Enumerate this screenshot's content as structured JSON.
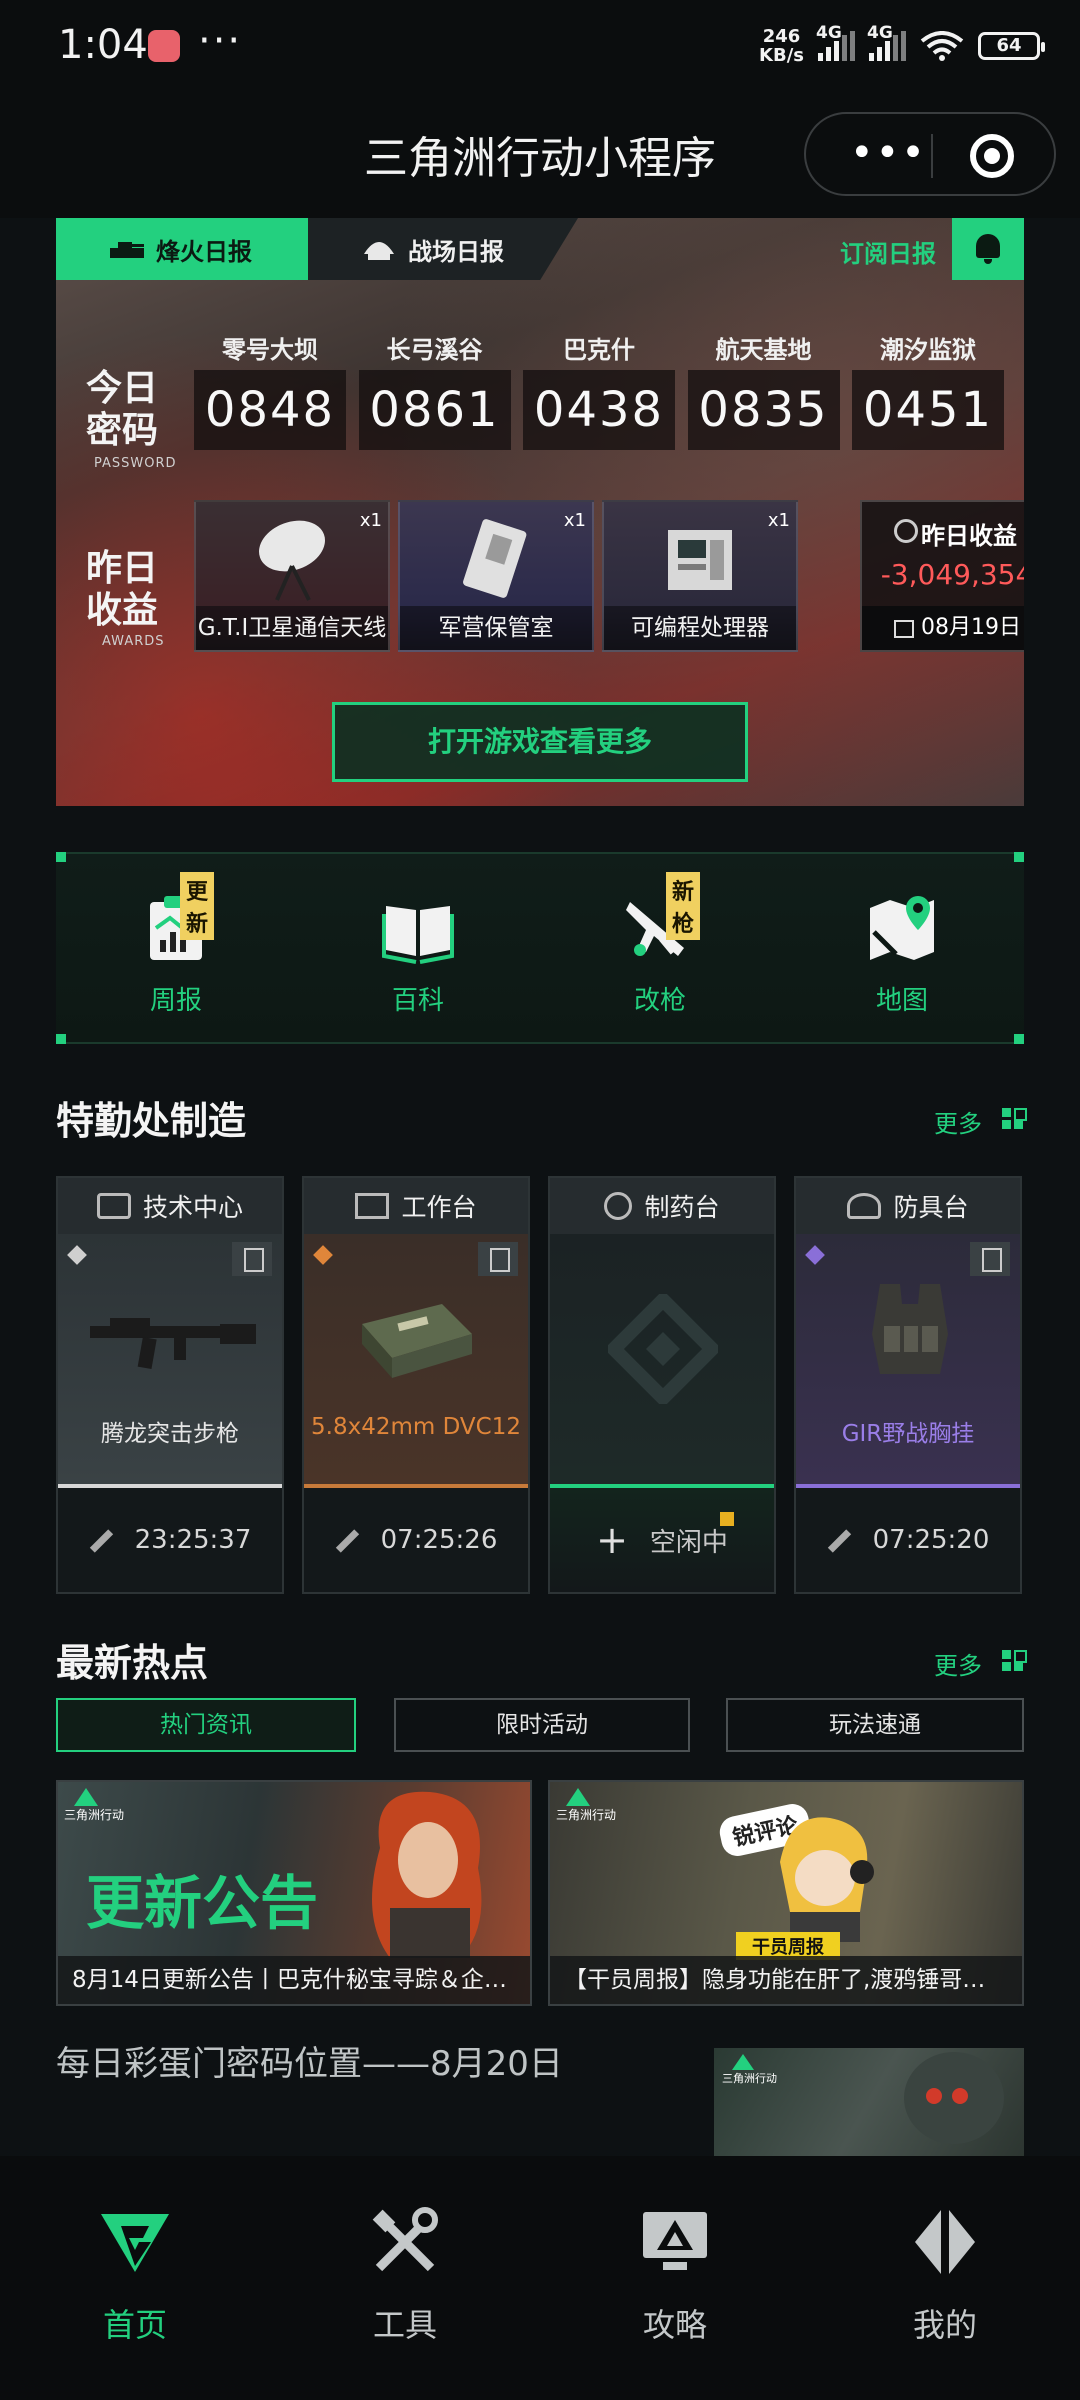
{
  "status_bar": {
    "time": "1:04",
    "more": "···",
    "speed_top": "246",
    "speed_bottom": "KB/s",
    "net1": "4G",
    "net2": "4G",
    "wifi_sub": "6",
    "battery": "64"
  },
  "title_bar": {
    "title": "三角洲行动小程序",
    "more_label": "•••"
  },
  "daily": {
    "tab_fire": "烽火日报",
    "tab_battle": "战场日报",
    "subscribe": "订阅日报",
    "password_label": "今日\n密码",
    "password_sub": "PASSWORD",
    "awards_label": "昨日\n收益",
    "awards_sub": "AWARDS",
    "codes": [
      {
        "map": "零号大坝",
        "code": "0848"
      },
      {
        "map": "长弓溪谷",
        "code": "0861"
      },
      {
        "map": "巴克什",
        "code": "0438"
      },
      {
        "map": "航天基地",
        "code": "0835"
      },
      {
        "map": "潮汐监狱",
        "code": "0451"
      }
    ],
    "awards": [
      {
        "name": "G.T.I卫星通信天线",
        "qty": "x1"
      },
      {
        "name": "军营保管室",
        "qty": "x1"
      },
      {
        "name": "可编程处理器",
        "qty": "x1"
      }
    ],
    "earnings_title": "昨日收益",
    "earnings_value": "-3,049,354",
    "earnings_date": "08月19日",
    "open_game": "打开游戏查看更多"
  },
  "quick_nav": [
    {
      "label": "周报",
      "badge": "更新",
      "icon": "weekly-report-icon"
    },
    {
      "label": "百科",
      "badge": "",
      "icon": "book-icon"
    },
    {
      "label": "改枪",
      "badge": "新枪",
      "icon": "rifle-icon"
    },
    {
      "label": "地图",
      "badge": "",
      "icon": "map-pin-icon"
    }
  ],
  "workshop": {
    "title": "特勤处制造",
    "more": "更多",
    "benches": [
      {
        "name": "技术中心",
        "item": "腾龙突击步枪",
        "time": "23:25:37",
        "item_color": "#e6e6e6",
        "bar_color": "#d8d8d8"
      },
      {
        "name": "工作台",
        "item": "5.8x42mm DVC12",
        "time": "07:25:26",
        "item_color": "#e0863a",
        "bar_color": "#c77a3a"
      },
      {
        "name": "制药台",
        "item": "",
        "time": "空闲中",
        "item_color": "#e6e6e6",
        "bar_color": "#23d07f"
      },
      {
        "name": "防具台",
        "item": "GIR野战胸挂",
        "time": "07:25:20",
        "item_color": "#9a7ee8",
        "bar_color": "#8a6fd8"
      }
    ]
  },
  "hot": {
    "title": "最新热点",
    "more": "更多",
    "tabs": [
      "热门资讯",
      "限时活动",
      "玩法速通"
    ],
    "logo_text": "三角洲行动",
    "news": [
      {
        "caption": "8月14日更新公告丨巴克什秘宝寻踪＆企…",
        "banner": "更新公告"
      },
      {
        "caption": "【干员周报】隐身功能在肝了,渡鸦锤哥…",
        "banner": "干员周报",
        "bubble": "锐评论"
      }
    ],
    "article_title": "每日彩蛋门密码位置——8月20日"
  },
  "bottom_nav": [
    {
      "label": "首页",
      "icon": "home-logo-icon",
      "active": true
    },
    {
      "label": "工具",
      "icon": "tools-icon",
      "active": false
    },
    {
      "label": "攻略",
      "icon": "guide-monitor-icon",
      "active": false
    },
    {
      "label": "我的",
      "icon": "profile-icon",
      "active": false
    }
  ],
  "colors": {
    "accent": "#23d07f",
    "negative": "#ff5a5a",
    "badge": "#f0d060"
  }
}
